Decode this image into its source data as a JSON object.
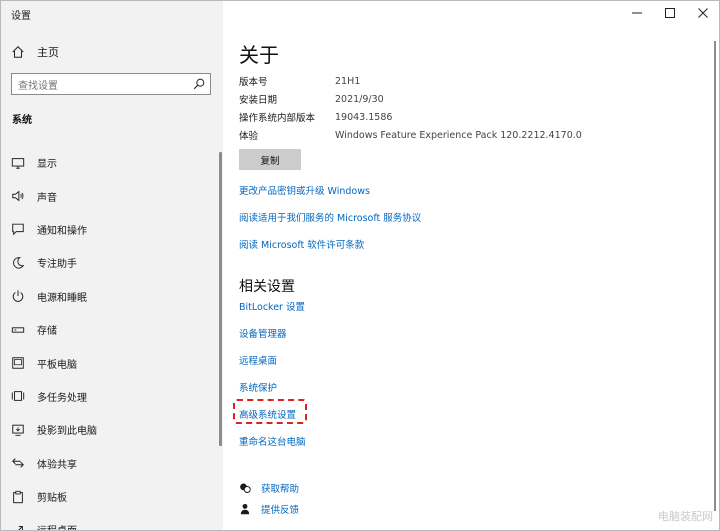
{
  "window": {
    "title": "设置"
  },
  "sidebar": {
    "home_label": "主页",
    "search_placeholder": "查找设置",
    "section_title": "系统",
    "items": [
      {
        "label": "显示",
        "icon": "display-icon"
      },
      {
        "label": "声音",
        "icon": "speaker-icon"
      },
      {
        "label": "通知和操作",
        "icon": "notification-icon"
      },
      {
        "label": "专注助手",
        "icon": "moon-icon"
      },
      {
        "label": "电源和睡眠",
        "icon": "power-icon"
      },
      {
        "label": "存储",
        "icon": "storage-icon"
      },
      {
        "label": "平板电脑",
        "icon": "tablet-icon"
      },
      {
        "label": "多任务处理",
        "icon": "multitask-icon"
      },
      {
        "label": "投影到此电脑",
        "icon": "project-icon"
      },
      {
        "label": "体验共享",
        "icon": "share-icon"
      },
      {
        "label": "剪贴板",
        "icon": "clipboard-icon"
      },
      {
        "label": "远程桌面",
        "icon": "remote-icon"
      }
    ]
  },
  "main": {
    "title": "关于",
    "specs": [
      {
        "label": "版本号",
        "value": "21H1"
      },
      {
        "label": "安装日期",
        "value": "2021/9/30"
      },
      {
        "label": "操作系统内部版本",
        "value": "19043.1586"
      },
      {
        "label": "体验",
        "value": "Windows Feature Experience Pack 120.2212.4170.0"
      }
    ],
    "copy_label": "复制",
    "links": [
      "更改产品密钥或升级 Windows",
      "阅读适用于我们服务的 Microsoft 服务协议",
      "阅读 Microsoft 软件许可条款"
    ],
    "related_title": "相关设置",
    "related_links": [
      "BitLocker 设置",
      "设备管理器",
      "远程桌面",
      "系统保护",
      "高级系统设置",
      "重命名这台电脑"
    ],
    "help_label": "获取帮助",
    "feedback_label": "提供反馈"
  },
  "colors": {
    "accent": "#0067c0",
    "highlight": "#e02020",
    "sidebar_bg": "#f2f2f2"
  },
  "watermark": "电脑装配网"
}
